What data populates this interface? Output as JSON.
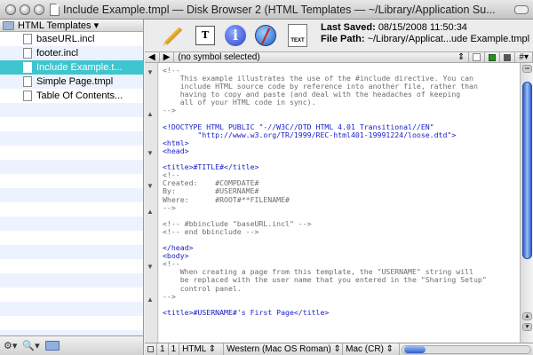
{
  "window": {
    "title": "Include Example.tmpl — Disk Browser 2 (HTML Templates — ~/Library/Application Su..."
  },
  "sidebar": {
    "header": "HTML Templates ▾",
    "items": [
      {
        "label": "baseURL.incl",
        "selected": false
      },
      {
        "label": "footer.incl",
        "selected": false
      },
      {
        "label": "Include Example.t...",
        "selected": true
      },
      {
        "label": "Simple Page.tmpl",
        "selected": false
      },
      {
        "label": "Table Of Contents...",
        "selected": false
      }
    ],
    "footer_gear": "⚙▾",
    "footer_search": "🔍▾"
  },
  "toolbar": {
    "template_icon_text": "T",
    "info_icon_text": "i",
    "text_icon_text": "TEXT",
    "last_saved_label": "Last Saved:",
    "last_saved_value": "08/15/2008 11:50:34",
    "file_path_label": "File Path:",
    "file_path_value": "~/Library/Applicat...ude Example.tmpl"
  },
  "navbar": {
    "back": "◀",
    "forward": "▶",
    "symbol": "(no symbol selected)",
    "sym_arrows": "⇕",
    "hash": "#▾"
  },
  "editor": {
    "lines": [
      {
        "t": "<!--",
        "c": "comment"
      },
      {
        "t": "    This example illustrates the use of the #include directive. You can",
        "c": "comment"
      },
      {
        "t": "    include HTML source code by reference into another file, rather than",
        "c": "comment"
      },
      {
        "t": "    having to copy and paste (and deal with the headaches of keeping",
        "c": "comment"
      },
      {
        "t": "    all of your HTML code in sync).",
        "c": "comment"
      },
      {
        "t": "-->",
        "c": "comment"
      },
      {
        "t": "",
        "c": "text"
      },
      {
        "t": "<!DOCTYPE HTML PUBLIC \"-//W3C//DTD HTML 4.01 Transitional//EN\"",
        "c": "tag"
      },
      {
        "t": "        \"http://www.w3.org/TR/1999/REC-html401-19991224/loose.dtd\">",
        "c": "tag"
      },
      {
        "t": "<html>",
        "c": "tag"
      },
      {
        "t": "<head>",
        "c": "tag"
      },
      {
        "t": "",
        "c": "text"
      },
      {
        "t": "<title>#TITLE#</title>",
        "c": "tag"
      },
      {
        "t": "<!--",
        "c": "comment"
      },
      {
        "t": "Created:    #COMPDATE#",
        "c": "comment"
      },
      {
        "t": "By:         #USERNAME#",
        "c": "comment"
      },
      {
        "t": "Where:      #ROOT#**FILENAME#",
        "c": "comment"
      },
      {
        "t": "-->",
        "c": "comment"
      },
      {
        "t": "",
        "c": "text"
      },
      {
        "t": "<!-- #bbinclude \"baseURL.incl\" -->",
        "c": "comment"
      },
      {
        "t": "<!-- end bbinclude -->",
        "c": "comment"
      },
      {
        "t": "",
        "c": "text"
      },
      {
        "t": "</head>",
        "c": "tag"
      },
      {
        "t": "<body>",
        "c": "tag"
      },
      {
        "t": "<!--",
        "c": "comment"
      },
      {
        "t": "    When creating a page from this template, the \"USERNAME\" string will",
        "c": "comment"
      },
      {
        "t": "    be replaced with the user name that you entered in the \"Sharing Setup\"",
        "c": "comment"
      },
      {
        "t": "    control panel.",
        "c": "comment"
      },
      {
        "t": "-->",
        "c": "comment"
      },
      {
        "t": "",
        "c": "text"
      },
      {
        "t": "<title>#USERNAME#'s First Page</title>",
        "c": "tag"
      }
    ]
  },
  "statusbar": {
    "line": "1",
    "col": "1",
    "language": "HTML ⇕",
    "encoding": "Western (Mac OS Roman) ⇕",
    "line_endings": "Mac (CR) ⇕"
  },
  "colors": {
    "selection": "#3ec5cf",
    "tag": "#1a20c8",
    "comment": "#6d6d6d"
  }
}
